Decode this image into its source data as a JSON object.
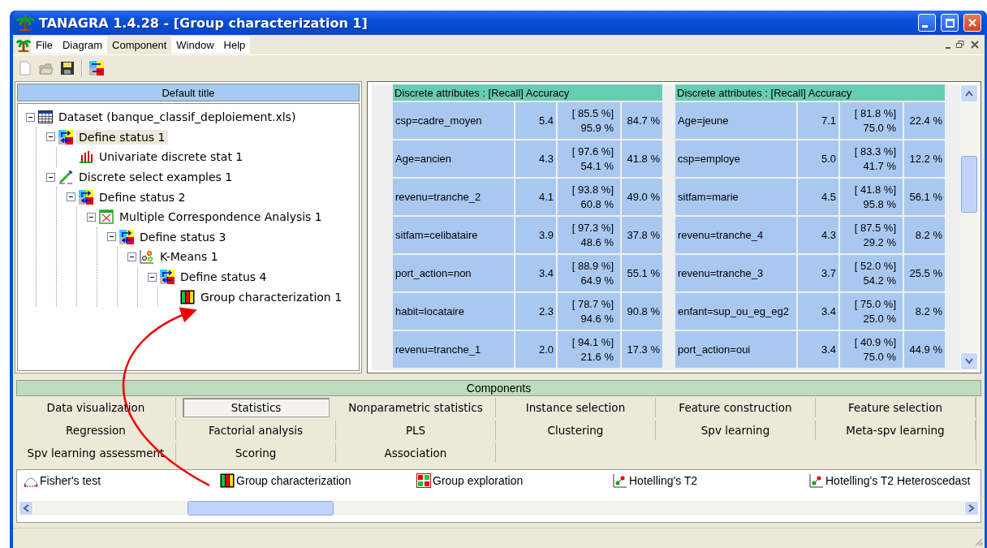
{
  "window": {
    "title": "TANAGRA 1.4.28 - [Group characterization 1]"
  },
  "menu": [
    {
      "label": "File",
      "selected": false
    },
    {
      "label": "Diagram",
      "selected": false
    },
    {
      "label": "Component",
      "selected": true
    },
    {
      "label": "Window",
      "selected": false
    },
    {
      "label": "Help",
      "selected": false
    }
  ],
  "diagram": {
    "title": "Default title",
    "tree": [
      {
        "kind": "dataset",
        "label": "Dataset (banque_classif_deploiement.xls)",
        "selected": false,
        "expanded": true,
        "children": [
          {
            "kind": "status",
            "label": "Define status 1",
            "selected": true,
            "expanded": true,
            "children": [
              {
                "kind": "barchart",
                "label": "Univariate discrete stat 1",
                "selected": false
              }
            ]
          },
          {
            "kind": "select",
            "label": "Discrete select examples 1",
            "selected": false,
            "expanded": true,
            "children": [
              {
                "kind": "status",
                "label": "Define status 2",
                "selected": false,
                "expanded": true,
                "children": [
                  {
                    "kind": "mca",
                    "label": "Multiple Correspondence Analysis 1",
                    "selected": false,
                    "expanded": true,
                    "children": [
                      {
                        "kind": "status",
                        "label": "Define status 3",
                        "selected": false,
                        "expanded": true,
                        "children": [
                          {
                            "kind": "kmeans",
                            "label": "K-Means 1",
                            "selected": false,
                            "expanded": true,
                            "children": [
                              {
                                "kind": "status",
                                "label": "Define status 4",
                                "selected": false,
                                "expanded": true,
                                "children": [
                                  {
                                    "kind": "groupchar",
                                    "label": "Group characterization 1",
                                    "selected": false
                                  }
                                ]
                              }
                            ]
                          }
                        ]
                      }
                    ]
                  }
                ]
              }
            ]
          }
        ]
      }
    ]
  },
  "results": {
    "tables": [
      {
        "header": "Discrete attributes :  [Recall] Accuracy",
        "rows": [
          {
            "attribute": "csp=cadre_moyen",
            "column_2": "5.4",
            "recall": "[ 85.5 %]",
            "accuracy": "95.9 %",
            "column_4": "84.7 %"
          },
          {
            "attribute": "Age=ancien",
            "column_2": "4.3",
            "recall": "[ 97.6 %]",
            "accuracy": "54.1 %",
            "column_4": "41.8 %"
          },
          {
            "attribute": "revenu=tranche_2",
            "column_2": "4.1",
            "recall": "[ 93.8 %]",
            "accuracy": "60.8 %",
            "column_4": "49.0 %"
          },
          {
            "attribute": "sitfam=celibataire",
            "column_2": "3.9",
            "recall": "[ 97.3 %]",
            "accuracy": "48.6 %",
            "column_4": "37.8 %"
          },
          {
            "attribute": "port_action=non",
            "column_2": "3.4",
            "recall": "[ 88.9 %]",
            "accuracy": "64.9 %",
            "column_4": "55.1 %"
          },
          {
            "attribute": "habit=locataire",
            "column_2": "2.3",
            "recall": "[ 78.7 %]",
            "accuracy": "94.6 %",
            "column_4": "90.8 %"
          },
          {
            "attribute": "revenu=tranche_1",
            "column_2": "2.0",
            "recall": "[ 94.1 %]",
            "accuracy": "21.6 %",
            "column_4": "17.3 %"
          }
        ]
      },
      {
        "header": "Discrete attributes :  [Recall] Accuracy",
        "rows": [
          {
            "attribute": "Age=jeune",
            "column_2": "7.1",
            "recall": "[ 81.8 %]",
            "accuracy": "75.0 %",
            "column_4": "22.4 %"
          },
          {
            "attribute": "csp=employe",
            "column_2": "5.0",
            "recall": "[ 83.3 %]",
            "accuracy": "41.7 %",
            "column_4": "12.2 %"
          },
          {
            "attribute": "sitfam=marie",
            "column_2": "4.5",
            "recall": "[ 41.8 %]",
            "accuracy": "95.8 %",
            "column_4": "56.1 %"
          },
          {
            "attribute": "revenu=tranche_4",
            "column_2": "4.3",
            "recall": "[ 87.5 %]",
            "accuracy": "29.2 %",
            "column_4": "8.2 %"
          },
          {
            "attribute": "revenu=tranche_3",
            "column_2": "3.7",
            "recall": "[ 52.0 %]",
            "accuracy": "54.2 %",
            "column_4": "25.5 %"
          },
          {
            "attribute": "enfant=sup_ou_eg_eg2",
            "column_2": "3.4",
            "recall": "[ 75.0 %]",
            "accuracy": "25.0 %",
            "column_4": "8.2 %"
          },
          {
            "attribute": "port_action=oui",
            "column_2": "3.4",
            "recall": "[ 40.9 %]",
            "accuracy": "75.0 %",
            "column_4": "44.9 %"
          }
        ]
      }
    ]
  },
  "components": {
    "title": "Components",
    "tabs": [
      {
        "label": "Data visualization",
        "selected": false
      },
      {
        "label": "Statistics",
        "selected": true
      },
      {
        "label": "Nonparametric statistics",
        "selected": false
      },
      {
        "label": "Instance selection",
        "selected": false
      },
      {
        "label": "Feature construction",
        "selected": false
      },
      {
        "label": "Feature selection",
        "selected": false
      },
      {
        "label": "Regression",
        "selected": false
      },
      {
        "label": "Factorial analysis",
        "selected": false
      },
      {
        "label": "PLS",
        "selected": false
      },
      {
        "label": "Clustering",
        "selected": false
      },
      {
        "label": "Spv learning",
        "selected": false
      },
      {
        "label": "Meta-spv learning",
        "selected": false
      },
      {
        "label": "Spv learning assessment",
        "selected": false
      },
      {
        "label": "Scoring",
        "selected": false
      },
      {
        "label": "Association",
        "selected": false
      }
    ],
    "items": [
      {
        "kind": "fisher",
        "label": "Fisher's test"
      },
      {
        "kind": "groupchar",
        "label": "Group characterization"
      },
      {
        "kind": "groupexp",
        "label": "Group exploration"
      },
      {
        "kind": "hotelling",
        "label": "Hotelling's T2"
      },
      {
        "kind": "hotelling",
        "label": "Hotelling's T2 Heteroscedast"
      }
    ]
  }
}
